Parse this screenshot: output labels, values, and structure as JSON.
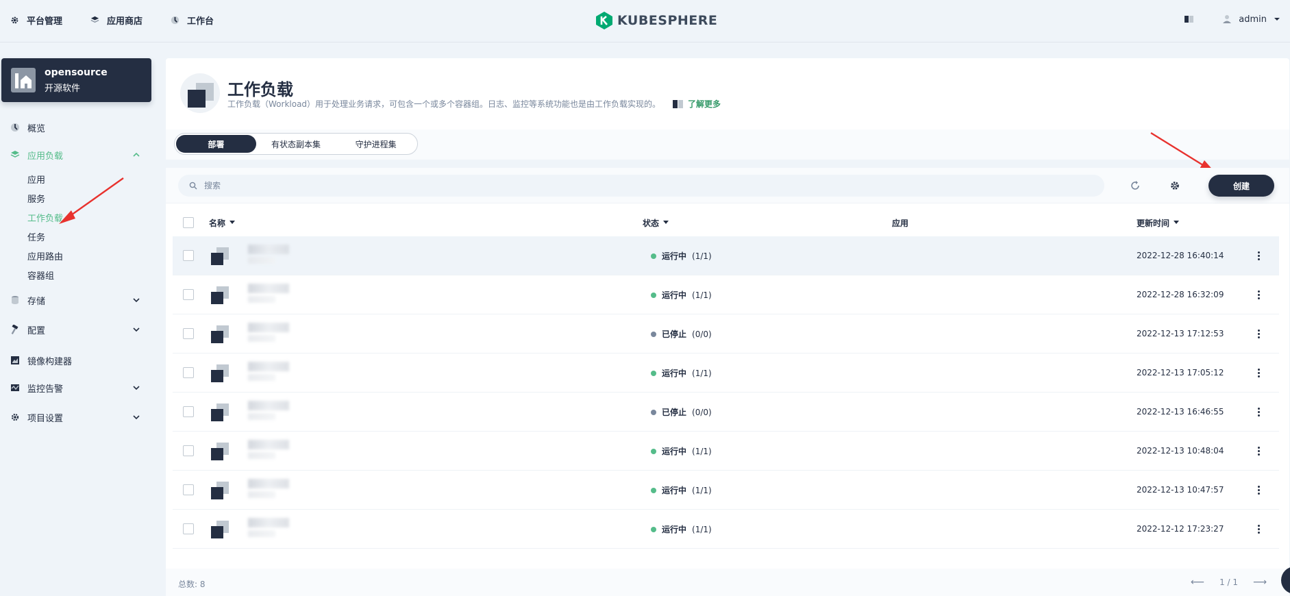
{
  "topnav": {
    "items": [
      {
        "label": "平台管理",
        "icon": "gear-icon"
      },
      {
        "label": "应用商店",
        "icon": "layers-icon"
      },
      {
        "label": "工作台",
        "icon": "dashboard-icon"
      }
    ],
    "logo_text": "KUBESPHERE",
    "user_name": "admin"
  },
  "workspace": {
    "name": "opensource",
    "description": "开源软件"
  },
  "sidebar": {
    "overview": "概览",
    "app_workloads": "应用负载",
    "sub_items": [
      "应用",
      "服务",
      "工作负载",
      "任务",
      "应用路由",
      "容器组"
    ],
    "storage": "存储",
    "config": "配置",
    "image_builder": "镜像构建器",
    "monitoring": "监控告警",
    "project_settings": "项目设置"
  },
  "page": {
    "title": "工作负载",
    "description": "工作负载（Workload）用于处理业务请求，可包含一个或多个容器组。日志、监控等系统功能也是由工作负载实现的。",
    "learn_more": "了解更多"
  },
  "tabs": [
    "部署",
    "有状态副本集",
    "守护进程集"
  ],
  "toolbar": {
    "search_placeholder": "搜索",
    "create_label": "创建"
  },
  "table": {
    "headers": {
      "name": "名称",
      "status": "状态",
      "app": "应用",
      "updated": "更新时间"
    },
    "rows": [
      {
        "status": "运行中",
        "count": "(1/1)",
        "time": "2022-12-28 16:40:14",
        "running": true
      },
      {
        "status": "运行中",
        "count": "(1/1)",
        "time": "2022-12-28 16:32:09",
        "running": true
      },
      {
        "status": "已停止",
        "count": "(0/0)",
        "time": "2022-12-13 17:12:53",
        "running": false
      },
      {
        "status": "运行中",
        "count": "(1/1)",
        "time": "2022-12-13 17:05:12",
        "running": true
      },
      {
        "status": "已停止",
        "count": "(0/0)",
        "time": "2022-12-13 16:46:55",
        "running": false
      },
      {
        "status": "运行中",
        "count": "(1/1)",
        "time": "2022-12-13 10:48:04",
        "running": true
      },
      {
        "status": "运行中",
        "count": "(1/1)",
        "time": "2022-12-13 10:47:57",
        "running": true
      },
      {
        "status": "运行中",
        "count": "(1/1)",
        "time": "2022-12-12 17:23:27",
        "running": true
      }
    ]
  },
  "footer": {
    "total": "总数: 8",
    "page": "1 / 1"
  },
  "colors": {
    "running": "#55bc8a",
    "stopped": "#79879c",
    "accent": "#55bc8a",
    "dark": "#242e42"
  }
}
